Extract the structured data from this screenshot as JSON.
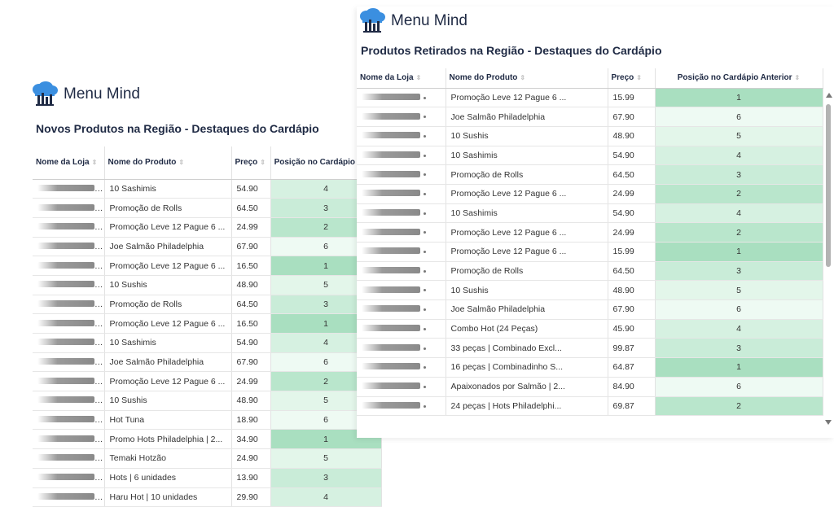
{
  "brand": {
    "name": "Menu Mind"
  },
  "colors": {
    "rank1": "#a9dfc0",
    "rank2": "#b9e6cc",
    "rank3": "#c9ecd8",
    "rank4": "#d6f1e1",
    "rank5": "#e3f6ea",
    "rank6": "#eefaf3"
  },
  "left_table": {
    "subtitle": "Novos Produtos na Região - Destaques do Cardápio",
    "columns": [
      "Nome da Loja",
      "Nome do Produto",
      "Preço",
      "Posição no Cardápio Atual"
    ],
    "rows": [
      {
        "produto": "10 Sashimis",
        "preco": "54.90",
        "pos": 4
      },
      {
        "produto": "Promoção de Rolls",
        "preco": "64.50",
        "pos": 3
      },
      {
        "produto": "Promoção Leve 12 Pague 6 ...",
        "preco": "24.99",
        "pos": 2
      },
      {
        "produto": "Joe Salmão Philadelphia",
        "preco": "67.90",
        "pos": 6
      },
      {
        "produto": "Promoção Leve 12 Pague 6 ...",
        "preco": "16.50",
        "pos": 1
      },
      {
        "produto": "10 Sushis",
        "preco": "48.90",
        "pos": 5
      },
      {
        "produto": "Promoção de Rolls",
        "preco": "64.50",
        "pos": 3
      },
      {
        "produto": "Promoção Leve 12 Pague 6 ...",
        "preco": "16.50",
        "pos": 1
      },
      {
        "produto": "10 Sashimis",
        "preco": "54.90",
        "pos": 4
      },
      {
        "produto": "Joe Salmão Philadelphia",
        "preco": "67.90",
        "pos": 6
      },
      {
        "produto": "Promoção Leve 12 Pague 6 ...",
        "preco": "24.99",
        "pos": 2
      },
      {
        "produto": "10 Sushis",
        "preco": "48.90",
        "pos": 5
      },
      {
        "produto": "Hot Tuna",
        "preco": "18.90",
        "pos": 6
      },
      {
        "produto": "Promo Hots Philadelphia | 2...",
        "preco": "34.90",
        "pos": 1
      },
      {
        "produto": "Temaki Hotzão",
        "preco": "24.90",
        "pos": 5
      },
      {
        "produto": "Hots | 6 unidades",
        "preco": "13.90",
        "pos": 3
      },
      {
        "produto": "Haru Hot | 10 unidades",
        "preco": "29.90",
        "pos": 4
      }
    ]
  },
  "right_table": {
    "subtitle": "Produtos Retirados na Região - Destaques do Cardápio",
    "columns": [
      "Nome da Loja",
      "Nome do Produto",
      "Preço",
      "Posição no Cardápio Anterior"
    ],
    "rows": [
      {
        "produto": "Promoção Leve 12 Pague 6 ...",
        "preco": "15.99",
        "pos": 1
      },
      {
        "produto": "Joe Salmão Philadelphia",
        "preco": "67.90",
        "pos": 6
      },
      {
        "produto": "10 Sushis",
        "preco": "48.90",
        "pos": 5
      },
      {
        "produto": "10 Sashimis",
        "preco": "54.90",
        "pos": 4
      },
      {
        "produto": "Promoção de Rolls",
        "preco": "64.50",
        "pos": 3
      },
      {
        "produto": "Promoção Leve 12 Pague 6 ...",
        "preco": "24.99",
        "pos": 2
      },
      {
        "produto": "10 Sashimis",
        "preco": "54.90",
        "pos": 4
      },
      {
        "produto": "Promoção Leve 12 Pague 6 ...",
        "preco": "24.99",
        "pos": 2
      },
      {
        "produto": "Promoção Leve 12 Pague 6 ...",
        "preco": "15.99",
        "pos": 1
      },
      {
        "produto": "Promoção de Rolls",
        "preco": "64.50",
        "pos": 3
      },
      {
        "produto": "10 Sushis",
        "preco": "48.90",
        "pos": 5
      },
      {
        "produto": "Joe Salmão Philadelphia",
        "preco": "67.90",
        "pos": 6
      },
      {
        "produto": "Combo Hot (24 Peças)",
        "preco": "45.90",
        "pos": 4
      },
      {
        "produto": "33 peças | Combinado Excl...",
        "preco": "99.87",
        "pos": 3
      },
      {
        "produto": "16 peças | Combinadinho S...",
        "preco": "64.87",
        "pos": 1
      },
      {
        "produto": "Apaixonados por Salmão | 2...",
        "preco": "84.90",
        "pos": 6
      },
      {
        "produto": "24 peças | Hots Philadelphi...",
        "preco": "69.87",
        "pos": 2
      }
    ]
  }
}
